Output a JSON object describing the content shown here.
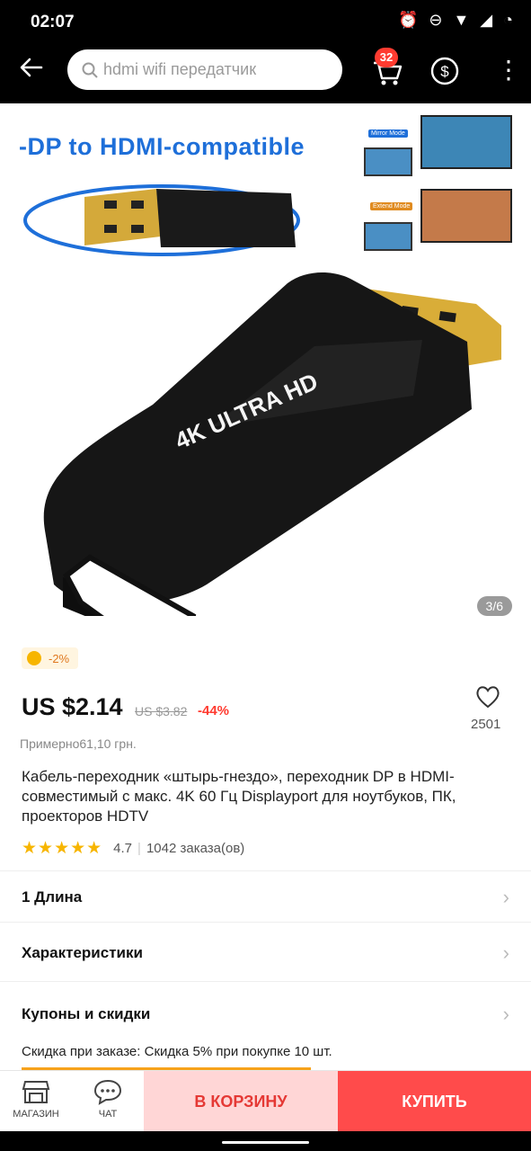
{
  "status_bar": {
    "time": "02:07"
  },
  "header": {
    "search_placeholder": "hdmi wifi передатчик",
    "cart_count": "32"
  },
  "hero": {
    "title": "-DP to HDMI-compatible",
    "image_counter": "3/6",
    "product_print": "4K ULTRA HD",
    "mode_labels": [
      "Mirror Mode",
      "Extend Mode"
    ]
  },
  "promo": {
    "badge": "-2%"
  },
  "pricing": {
    "price": "US $2.14",
    "old_price": "US $3.82",
    "discount": "-44%",
    "approx": "Примерно61,10 грн."
  },
  "favorites": {
    "count": "2501"
  },
  "product": {
    "title": "Кабель-переходник «штырь-гнездо», переходник DP в HDMI-совместимый с макс. 4K 60 Гц Displayport для ноутбуков, ПК, проекторов HDTV"
  },
  "rating": {
    "stars": "★★★★★",
    "score": "4.7",
    "orders": "1042 заказа(ов)"
  },
  "sections": {
    "length": "1 Длина",
    "specs": "Характеристики",
    "coupons": "Купоны и скидки"
  },
  "coupon_note": "Скидка при заказе: Скидка 5% при покупке 10 шт.",
  "bottom_nav": {
    "store": "МАГАЗИН",
    "chat": "ЧАТ",
    "add_to_cart": "В КОРЗИНУ",
    "buy": "КУПИТЬ"
  },
  "colors": {
    "accent": "#ff4b4b",
    "title_blue": "#1e6fd9",
    "cart_bg": "#ffd6d6"
  }
}
